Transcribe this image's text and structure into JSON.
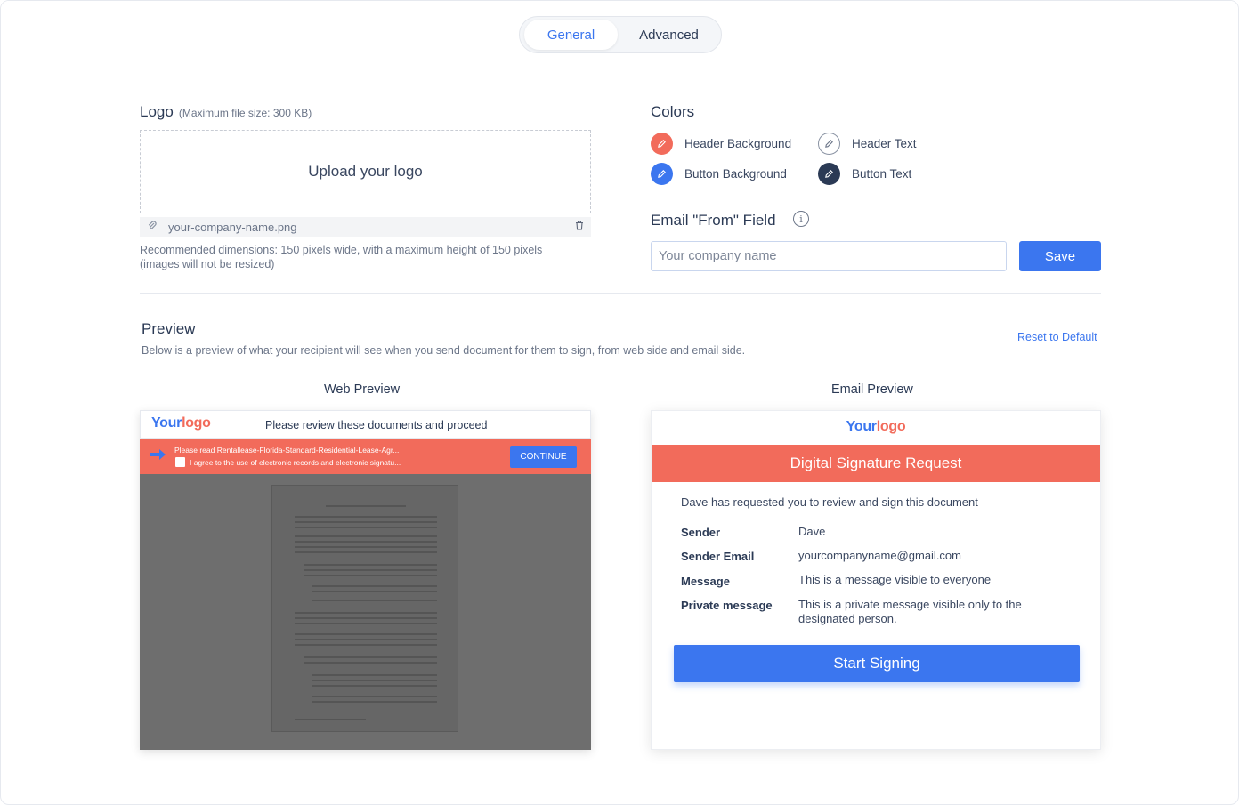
{
  "tabs": [
    {
      "label": "General",
      "active": true
    },
    {
      "label": "Advanced",
      "active": false
    }
  ],
  "logo": {
    "title": "Logo",
    "hint": "(Maximum file size: 300 KB)",
    "upload_label": "Upload your logo",
    "file_name": "your-company-name.png",
    "recommendation": "Recommended dimensions: 150 pixels wide, with a maximum height of 150 pixels (images will not be resized)"
  },
  "colors": {
    "title": "Colors",
    "items": [
      {
        "label": "Header Background",
        "color": "#f26b5b",
        "icon": "pencil-icon"
      },
      {
        "label": "Header Text",
        "color": "#ffffff",
        "icon": "pencil-icon"
      },
      {
        "label": "Button Background",
        "color": "#3b76ef",
        "icon": "pencil-icon"
      },
      {
        "label": "Button Text",
        "color": "#2b3a55",
        "icon": "pencil-icon"
      }
    ]
  },
  "email_from": {
    "title": "Email \"From\" Field",
    "placeholder": "Your company name",
    "value": "",
    "save_label": "Save"
  },
  "preview": {
    "title": "Preview",
    "description": "Below is a preview of what your recipient will see when you send document for them to sign, from web side and email side.",
    "reset_label": "Reset to Default",
    "web_title": "Web Preview",
    "email_title": "Email Preview"
  },
  "web_preview": {
    "logo_part1": "Your",
    "logo_part2": "logo",
    "header_message": "Please review these documents and proceed",
    "banner_line1": "Please read Rentallease-Florida-Standard-Residential-Lease-Agr...",
    "banner_line2": "I agree to the use of electronic records and electronic signatu...",
    "continue_label": "CONTINUE"
  },
  "email_preview": {
    "logo_part1": "Your",
    "logo_part2": "logo",
    "banner": "Digital Signature Request",
    "intro": "Dave has requested you to review and sign this document",
    "fields": [
      {
        "key": "Sender",
        "value": "Dave"
      },
      {
        "key": "Sender Email",
        "value": "yourcompanyname@gmail.com"
      },
      {
        "key": "Message",
        "value": "This is a message visible to everyone"
      },
      {
        "key": "Private message",
        "value": "This is a private message visible only to the designated person."
      }
    ],
    "button_label": "Start Signing"
  },
  "theme": {
    "accent": "#3b76ef",
    "brand_red": "#f26b5b"
  }
}
